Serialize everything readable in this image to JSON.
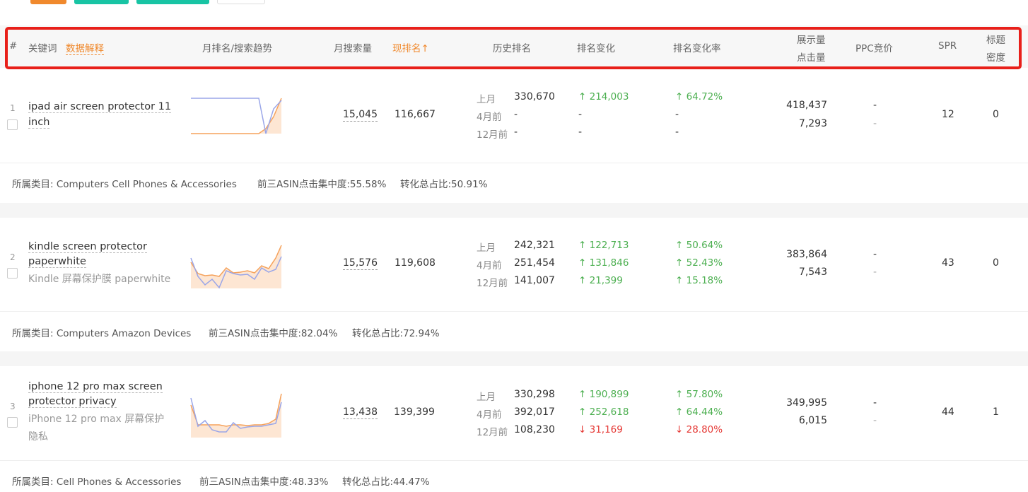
{
  "header": {
    "index": "#",
    "keyword": "关键词",
    "data_explain": "数据解释",
    "trend": "月排名/搜索趋势",
    "monthly_search": "月搜索量",
    "current_rank": "现排名↑",
    "history_rank": "历史排名",
    "rank_change": "排名变化",
    "rank_change_rate": "排名变化率",
    "impressions": "展示量",
    "clicks": "点击量",
    "ppc": "PPC竞价",
    "spr": "SPR",
    "title_density_1": "标题",
    "title_density_2": "密度"
  },
  "history_labels": [
    "上月",
    "4月前",
    "12月前"
  ],
  "rows": [
    {
      "index": "1",
      "keyword_line1": "ipad air screen protector 11",
      "keyword_line2": "inch",
      "cn": "",
      "monthly_search": "15,045",
      "current_rank": "116,667",
      "history": [
        "330,670",
        "-",
        "-"
      ],
      "change": [
        "↑ 214,003",
        "-",
        "-"
      ],
      "rate": [
        "↑ 64.72%",
        "-",
        "-"
      ],
      "impressions": "418,437",
      "clicks": "7,293",
      "ppc1": "-",
      "ppc2": "-",
      "spr": "12",
      "density": "0",
      "category": "所属类目: Computers Cell Phones & Accessories",
      "top3": "前三ASIN点击集中度:55.58%",
      "conversion": "转化总占比:50.91%"
    },
    {
      "index": "2",
      "keyword_line1": "kindle screen protector",
      "keyword_line2": "paperwhite",
      "cn": "Kindle 屏幕保护膜 paperwhite",
      "monthly_search": "15,576",
      "current_rank": "119,608",
      "history": [
        "242,321",
        "251,454",
        "141,007"
      ],
      "change": [
        "↑ 122,713",
        "↑ 131,846",
        "↑ 21,399"
      ],
      "rate": [
        "↑ 50.64%",
        "↑ 52.43%",
        "↑ 15.18%"
      ],
      "impressions": "383,864",
      "clicks": "7,543",
      "ppc1": "-",
      "ppc2": "-",
      "spr": "43",
      "density": "0",
      "category": "所属类目: Computers Amazon Devices",
      "top3": "前三ASIN点击集中度:82.04%",
      "conversion": "转化总占比:72.94%"
    },
    {
      "index": "3",
      "keyword_line1": "iphone 12 pro max screen",
      "keyword_line2": "protector privacy",
      "cn": "iPhone 12 pro max 屏幕保护",
      "cn2": "隐私",
      "monthly_search": "13,438",
      "current_rank": "139,399",
      "history": [
        "330,298",
        "392,017",
        "108,230"
      ],
      "change": [
        "↑ 190,899",
        "↑ 252,618",
        "↓ 31,169"
      ],
      "rate": [
        "↑ 57.80%",
        "↑ 64.44%",
        "↓ 28.80%"
      ],
      "impressions": "349,995",
      "clicks": "6,015",
      "ppc1": "-",
      "ppc2": "-",
      "spr": "44",
      "density": "1",
      "category": "所属类目: Cell Phones & Accessories",
      "top3": "前三ASIN点击集中度:48.33%",
      "conversion": "转化总占比:44.47%"
    }
  ],
  "colors": {
    "accent": "#f0892d",
    "teal": "#18c4a4",
    "green": "#4caf50",
    "red": "#e53935",
    "highlight": "#e8201a"
  }
}
